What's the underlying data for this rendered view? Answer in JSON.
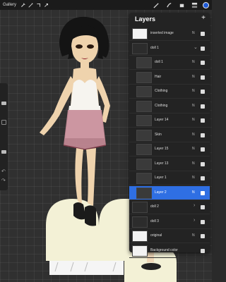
{
  "app": {
    "gallery_label": "Gallery"
  },
  "toolbar": {
    "left_tools": [
      "wrench-icon",
      "magic-wand-icon",
      "selection-icon",
      "transform-icon"
    ],
    "right_tools": [
      "brush-icon",
      "smudge-icon",
      "eraser-icon",
      "layers-icon"
    ],
    "color": "#1f5ad6"
  },
  "layers_panel": {
    "title": "Layers",
    "add_label": "+",
    "rows": [
      {
        "name": "inserted image",
        "mode": "N",
        "visible": true,
        "type": "layer",
        "thumb": "image"
      },
      {
        "name": "doll 1",
        "mode": "",
        "visible": true,
        "type": "group",
        "expanded": true
      },
      {
        "name": "doll 1",
        "mode": "N",
        "visible": true,
        "type": "child"
      },
      {
        "name": "Hair",
        "mode": "N",
        "visible": true,
        "type": "child"
      },
      {
        "name": "Clothing",
        "mode": "N",
        "visible": true,
        "type": "child"
      },
      {
        "name": "Clothing",
        "mode": "N",
        "visible": true,
        "type": "child"
      },
      {
        "name": "Layer 14",
        "mode": "N",
        "visible": true,
        "type": "child"
      },
      {
        "name": "Skin",
        "mode": "N",
        "visible": true,
        "type": "child"
      },
      {
        "name": "Layer 15",
        "mode": "N",
        "visible": true,
        "type": "child"
      },
      {
        "name": "Layer 13",
        "mode": "N",
        "visible": true,
        "type": "child"
      },
      {
        "name": "Layer 1",
        "mode": "N",
        "visible": true,
        "type": "child"
      },
      {
        "name": "Layer 2",
        "mode": "N",
        "visible": true,
        "type": "child",
        "selected": true
      },
      {
        "name": "doll 2",
        "mode": "",
        "visible": true,
        "type": "group",
        "expanded": false
      },
      {
        "name": "doll 3",
        "mode": "",
        "visible": true,
        "type": "group",
        "expanded": false
      },
      {
        "name": "original",
        "mode": "N",
        "visible": true,
        "type": "layer"
      },
      {
        "name": "Background color",
        "mode": "",
        "visible": true,
        "type": "layer"
      }
    ]
  }
}
